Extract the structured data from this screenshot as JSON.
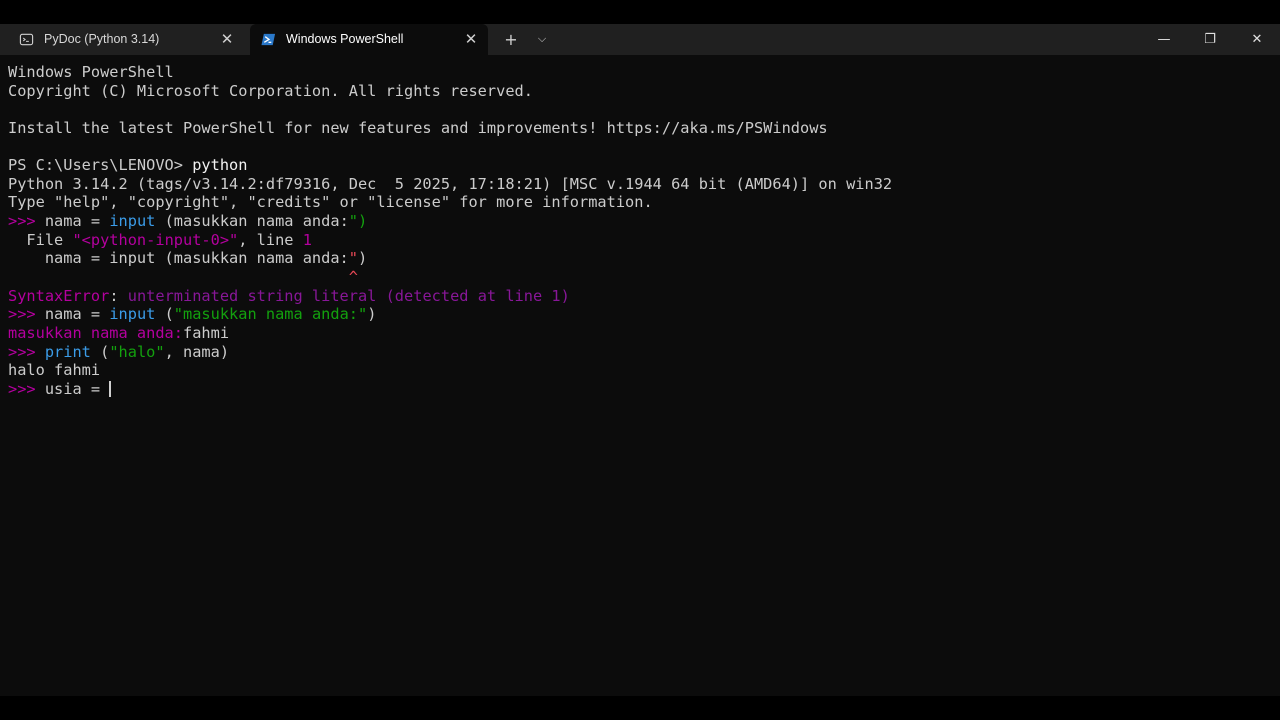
{
  "tabs": [
    {
      "label": "PyDoc (Python 3.14)",
      "icon": "terminal-icon",
      "active": false
    },
    {
      "label": "Windows PowerShell",
      "icon": "powershell-icon",
      "active": true
    }
  ],
  "titlebar": {
    "new_tab_glyph": "+",
    "dropdown_glyph": "⌵",
    "close_glyph": "✕",
    "minimize_glyph": "—",
    "maximize_glyph": "❐",
    "window_close_glyph": "✕"
  },
  "colors": {
    "background": "#0c0c0c",
    "prompt": "#b4009e",
    "keyword": "#3b9ce8",
    "string": "#13a10e",
    "error": "#b4009e"
  },
  "terminal": {
    "lines": [
      [
        {
          "t": "Windows PowerShell",
          "c": "default"
        }
      ],
      [
        {
          "t": "Copyright (C) Microsoft Corporation. All rights reserved.",
          "c": "default"
        }
      ],
      [
        {
          "t": "",
          "c": "default"
        }
      ],
      [
        {
          "t": "Install the latest PowerShell for new features and improvements! https://aka.ms/PSWindows",
          "c": "default"
        }
      ],
      [
        {
          "t": "",
          "c": "default"
        }
      ],
      [
        {
          "t": "PS C:\\Users\\LENOVO> ",
          "c": "default"
        },
        {
          "t": "python",
          "c": "white"
        }
      ],
      [
        {
          "t": "Python 3.14.2 (tags/v3.14.2:df79316, Dec  5 2025, 17:18:21) [MSC v.1944 64 bit (AMD64)] on win32",
          "c": "default"
        }
      ],
      [
        {
          "t": "Type \"help\", \"copyright\", \"credits\" or \"license\" for more information.",
          "c": "default"
        }
      ],
      [
        {
          "t": ">>> ",
          "c": "magenta"
        },
        {
          "t": "nama = ",
          "c": "default"
        },
        {
          "t": "input",
          "c": "blue"
        },
        {
          "t": " (masukkan nama anda:",
          "c": "default"
        },
        {
          "t": "\")",
          "c": "green"
        }
      ],
      [
        {
          "t": "  File ",
          "c": "default"
        },
        {
          "t": "\"<python-input-0>\"",
          "c": "magenta"
        },
        {
          "t": ", line ",
          "c": "default"
        },
        {
          "t": "1",
          "c": "magenta"
        }
      ],
      [
        {
          "t": "    nama = input (masukkan nama anda:",
          "c": "default"
        },
        {
          "t": "\"",
          "c": "red"
        },
        {
          "t": ")",
          "c": "default"
        }
      ],
      [
        {
          "t": "                                     ",
          "c": "default"
        },
        {
          "t": "^",
          "c": "red"
        }
      ],
      [
        {
          "t": "SyntaxError",
          "c": "magenta"
        },
        {
          "t": ": ",
          "c": "default"
        },
        {
          "t": "unterminated string literal (detected at line 1)",
          "c": "purple"
        }
      ],
      [
        {
          "t": ">>> ",
          "c": "magenta"
        },
        {
          "t": "nama = ",
          "c": "default"
        },
        {
          "t": "input",
          "c": "blue"
        },
        {
          "t": " (",
          "c": "default"
        },
        {
          "t": "\"masukkan nama anda:\"",
          "c": "green"
        },
        {
          "t": ")",
          "c": "default"
        }
      ],
      [
        {
          "t": "masukkan nama anda:",
          "c": "magenta"
        },
        {
          "t": "fahmi",
          "c": "default"
        }
      ],
      [
        {
          "t": ">>> ",
          "c": "magenta"
        },
        {
          "t": "print",
          "c": "blue"
        },
        {
          "t": " (",
          "c": "default"
        },
        {
          "t": "\"halo\"",
          "c": "green"
        },
        {
          "t": ", nama)",
          "c": "default"
        }
      ],
      [
        {
          "t": "halo fahmi",
          "c": "default"
        }
      ],
      [
        {
          "t": ">>> ",
          "c": "magenta"
        },
        {
          "t": "usia = ",
          "c": "default"
        }
      ]
    ]
  }
}
